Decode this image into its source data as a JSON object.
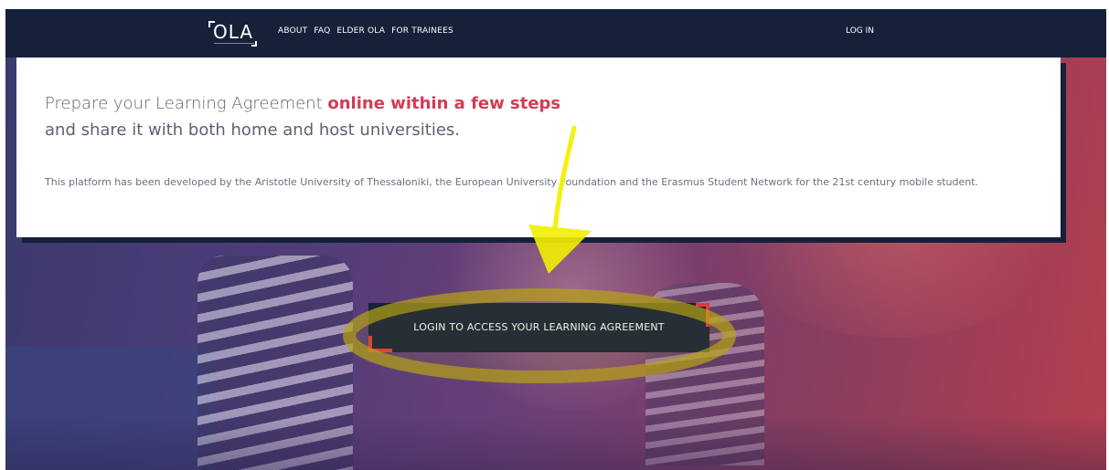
{
  "header": {
    "logo_text": "OLA",
    "nav": [
      {
        "label": "ABOUT"
      },
      {
        "label": "FAQ"
      },
      {
        "label": "ELDER OLA"
      },
      {
        "label": "FOR TRAINEES"
      }
    ],
    "login_label": "LOG IN"
  },
  "intro": {
    "line1_prefix": "Prepare your Learning Agreement ",
    "line1_highlight": "online within a few steps",
    "line2": "and share it with both home and host universities.",
    "description": "This platform has been developed by the Aristotle University of Thessaloniki, the European University Foundation and the Erasmus Student Network for the 21st century mobile student."
  },
  "cta": {
    "label": "LOGIN TO ACCESS YOUR LEARNING AGREEMENT"
  },
  "colors": {
    "navy": "#152039",
    "accent_red": "#d43a54",
    "corner_red": "#e23a3a",
    "annotation_yellow": "#f2f000"
  }
}
